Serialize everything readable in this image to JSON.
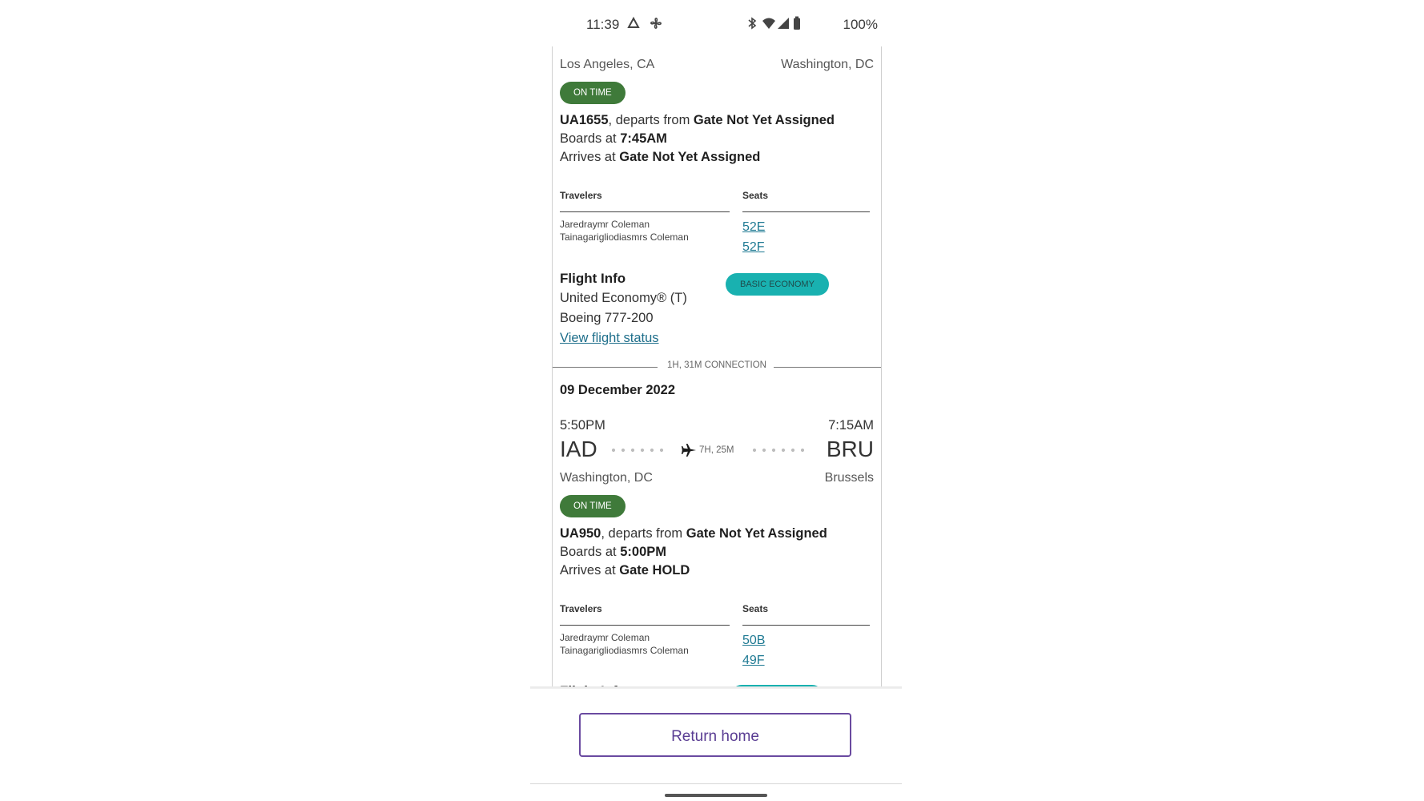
{
  "status_bar": {
    "time": "11:39",
    "battery": "100%"
  },
  "segment1": {
    "origin_city": "Los Angeles, CA",
    "dest_city": "Washington, DC",
    "status": "ON TIME",
    "flight": "UA1655",
    "departs_text": ", departs from ",
    "depart_gate": "Gate Not Yet Assigned",
    "boards_text": "Boards at ",
    "boards_time": "7:45AM",
    "arrives_text": "Arrives at ",
    "arrive_gate": "Gate Not Yet Assigned",
    "travelers_header": "Travelers",
    "seats_header": "Seats",
    "travelers": [
      "Jaredraymr Coleman",
      "Tainagarigliodiasmrs Coleman"
    ],
    "seats": [
      "52E",
      "52F"
    ],
    "flight_info_title": "Flight Info",
    "cabin": "United Economy® (T)",
    "aircraft": "Boeing 777-200",
    "status_link": "View flight status",
    "fare_badge": "BASIC ECONOMY"
  },
  "connection": "1H, 31M CONNECTION",
  "segment2": {
    "date": "09 December 2022",
    "depart_time": "5:50PM",
    "arrive_time": "7:15AM",
    "origin_code": "IAD",
    "dest_code": "BRU",
    "duration": "7H, 25M",
    "origin_city": "Washington, DC",
    "dest_city": "Brussels",
    "status": "ON TIME",
    "flight": "UA950",
    "departs_text": ", departs from ",
    "depart_gate": "Gate Not Yet Assigned",
    "boards_text": "Boards at ",
    "boards_time": "5:00PM",
    "arrives_text": "Arrives at ",
    "arrive_gate": "Gate HOLD",
    "travelers_header": "Travelers",
    "seats_header": "Seats",
    "travelers": [
      "Jaredraymr Coleman",
      "Tainagarigliodiasmrs Coleman"
    ],
    "seats": [
      "50B",
      "49F"
    ]
  },
  "footer": {
    "return_home": "Return home"
  },
  "colors": {
    "on_time": "#3f7a3a",
    "basic_economy": "#19b1b0",
    "button_border": "#6a4aa0",
    "link": "#1f7a93"
  },
  "icons": [
    "photos-icon",
    "fan-icon",
    "bluetooth-icon",
    "wifi-icon",
    "signal-icon",
    "battery-icon",
    "airplane-icon"
  ]
}
